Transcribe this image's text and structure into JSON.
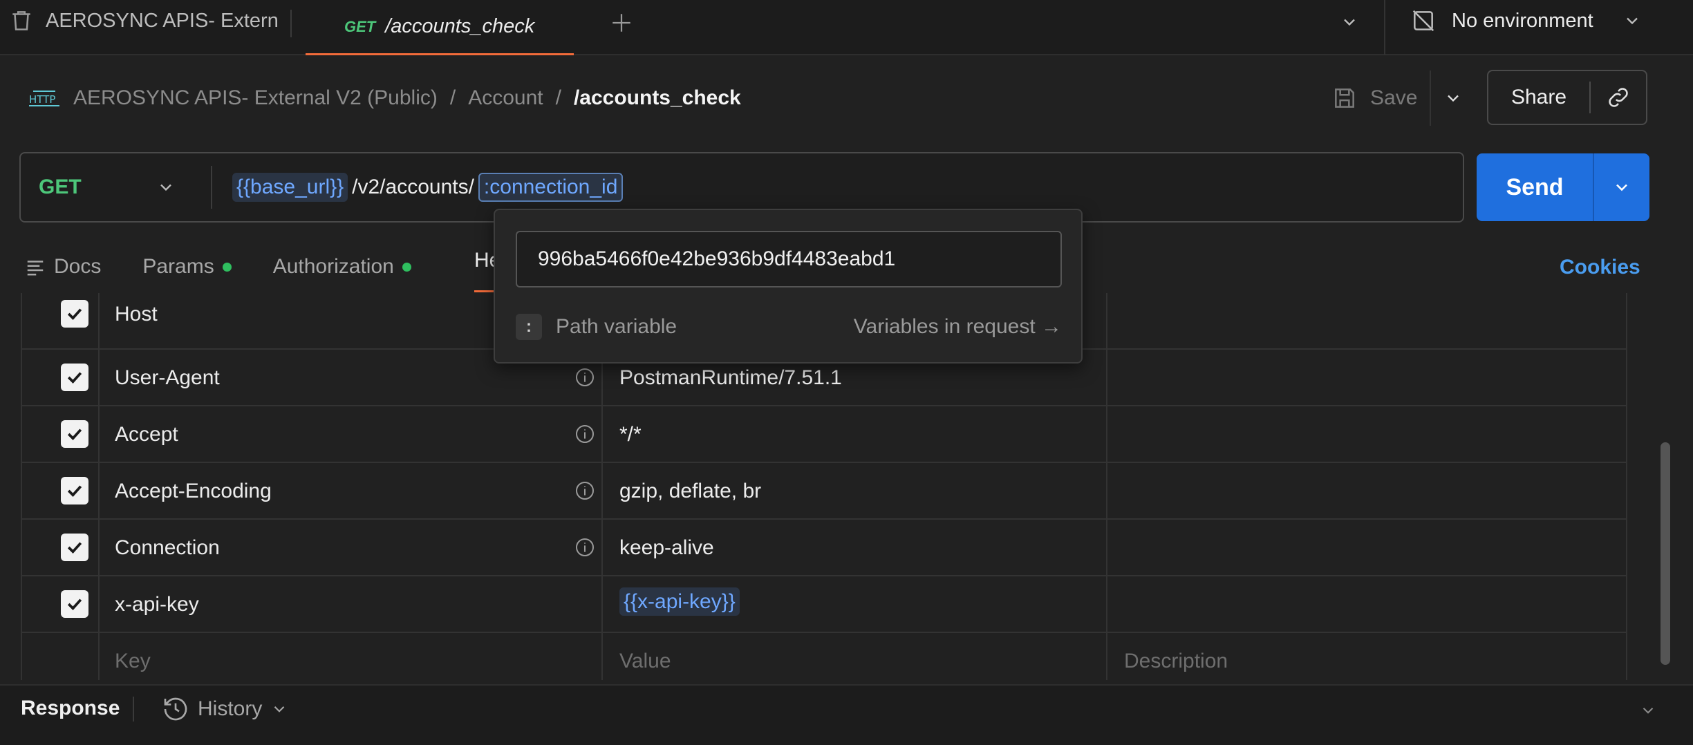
{
  "tabs": {
    "collection_tab": "AEROSYNC APIS- Extern",
    "active_tab": {
      "method": "GET",
      "title": "/accounts_check"
    }
  },
  "environment": {
    "label": "No environment"
  },
  "breadcrumb": {
    "icon": "HTTP",
    "items": [
      "AEROSYNC APIS- External V2 (Public)",
      "Account"
    ],
    "separator": "/",
    "current": "/accounts_check"
  },
  "toolbar": {
    "save_label": "Save",
    "share_label": "Share"
  },
  "request": {
    "method": "GET",
    "url_var": "{{base_url}}",
    "url_path": "/v2/accounts/",
    "url_path_var": ":connection_id",
    "send_label": "Send"
  },
  "subtabs": {
    "docs": "Docs",
    "params": "Params",
    "authorization": "Authorization",
    "headers_partial": "He",
    "cookies": "Cookies"
  },
  "headers": {
    "rows": [
      {
        "key": "Host",
        "value": ""
      },
      {
        "key": "User-Agent",
        "value": "PostmanRuntime/7.51.1"
      },
      {
        "key": "Accept",
        "value": "*/*"
      },
      {
        "key": "Accept-Encoding",
        "value": "gzip, deflate, br"
      },
      {
        "key": "Connection",
        "value": "keep-alive"
      },
      {
        "key": "x-api-key",
        "value": "{{x-api-key}}"
      }
    ],
    "placeholders": {
      "key": "Key",
      "value": "Value",
      "description": "Description"
    }
  },
  "popup": {
    "value": "996ba5466f0e42be936b9df4483eabd1",
    "chip": ":",
    "type_label": "Path variable",
    "link_label": "Variables in request →"
  },
  "bottom": {
    "response": "Response",
    "history": "History"
  },
  "colors": {
    "accent_orange": "#f26b3a",
    "get_green": "#4dc77a",
    "send_blue": "#1f6fde",
    "var_blue": "#6fa8ff",
    "cookies_blue": "#4a9df0"
  }
}
